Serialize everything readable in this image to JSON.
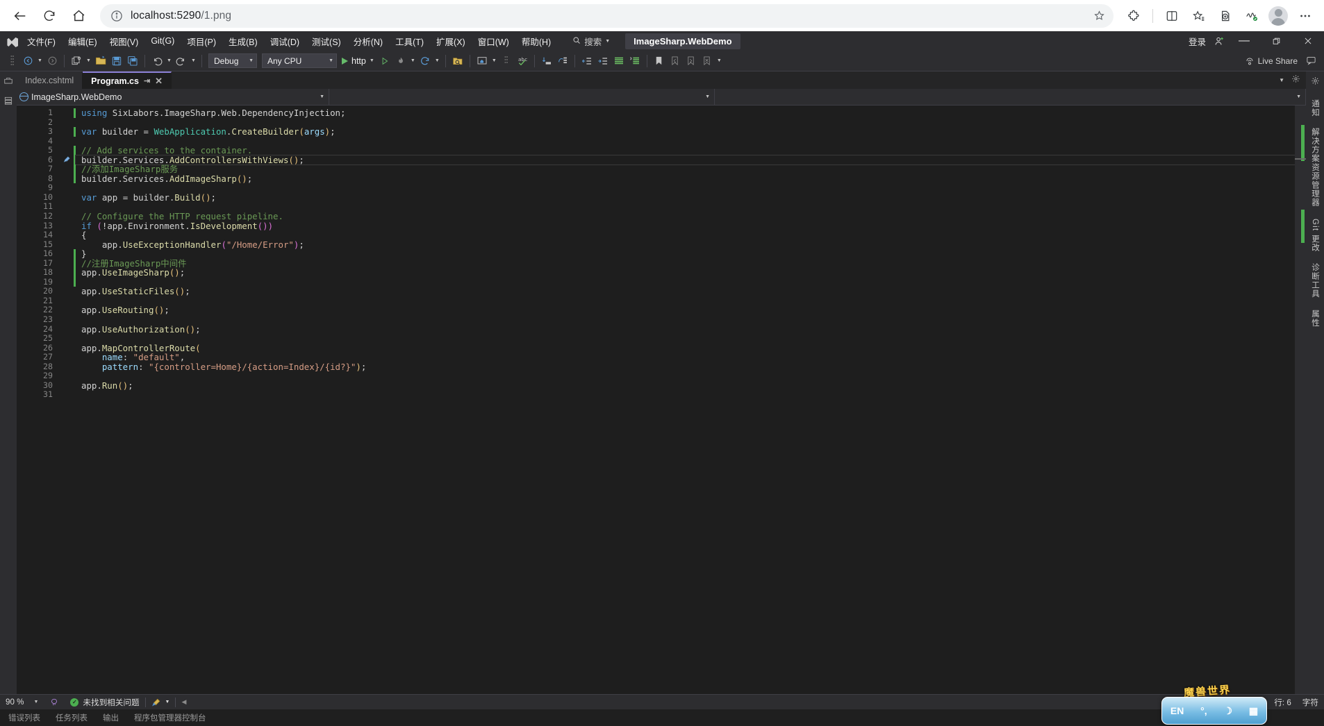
{
  "browser": {
    "url_host": "localhost:5290",
    "url_path": "/1.png",
    "back_icon": "back-arrow-icon",
    "reload_icon": "reload-icon",
    "home_icon": "home-icon",
    "info_icon": "info-circle-icon",
    "star_icon": "favorite-star-icon",
    "extensions_icon": "extensions-puzzle-icon",
    "split_icon": "split-screen-icon",
    "collections_icon": "collections-icon",
    "add_tab_icon": "add-to-collection-icon",
    "performance_icon": "browser-essentials-icon",
    "profile_icon": "profile-avatar-icon",
    "more_icon": "more-settings-icon"
  },
  "vs": {
    "menus": [
      {
        "label": "文件(F)",
        "key": "F"
      },
      {
        "label": "编辑(E)",
        "key": "E"
      },
      {
        "label": "视图(V)",
        "key": "V"
      },
      {
        "label": "Git(G)",
        "key": "G"
      },
      {
        "label": "项目(P)",
        "key": "P"
      },
      {
        "label": "生成(B)",
        "key": "B"
      },
      {
        "label": "调试(D)",
        "key": "D"
      },
      {
        "label": "测试(S)",
        "key": "S"
      },
      {
        "label": "分析(N)",
        "key": "N"
      },
      {
        "label": "工具(T)",
        "key": "T"
      },
      {
        "label": "扩展(X)",
        "key": "X"
      },
      {
        "label": "窗口(W)",
        "key": "W"
      },
      {
        "label": "帮助(H)",
        "key": "H"
      }
    ],
    "search_label": "搜索",
    "solution_title": "ImageSharp.WebDemo",
    "signin_label": "登录",
    "window_minimize": "—",
    "window_restore": "❐",
    "window_close": "✕",
    "toolbar": {
      "configuration": "Debug",
      "platform": "Any CPU",
      "run_target": "http",
      "live_share": "Live Share"
    },
    "tabs": [
      {
        "label": "Index.cshtml",
        "active": false
      },
      {
        "label": "Program.cs",
        "active": true
      }
    ],
    "navbar": {
      "project": "ImageSharp.WebDemo",
      "type": "",
      "member": ""
    },
    "right_rail": [
      "通知",
      "解决方案资源管理器",
      "Git 更改",
      "诊断工具",
      "属性"
    ],
    "statusbar": {
      "zoom": "90 %",
      "issues": "未找到相关问题",
      "line_label": "行: 6",
      "col_label": "字符"
    },
    "bottom_tabs": [
      "错误列表",
      "任务列表",
      "输出",
      "程序包管理器控制台"
    ],
    "ime": {
      "lang": "EN",
      "punct": "°,",
      "moon": "☽",
      "keyboard": "▦",
      "banner": "魔兽世界"
    }
  },
  "code": {
    "language": "csharp",
    "current_line": 6,
    "lines": [
      {
        "n": 1,
        "change": true,
        "html": "<span class=\"k\">using</span> SixLabors.ImageSharp.Web.DependencyInjection;"
      },
      {
        "n": 2,
        "change": false,
        "html": ""
      },
      {
        "n": 3,
        "change": true,
        "html": "<span class=\"k\">var</span> builder = <span class=\"t\">WebApplication</span>.<span class=\"m\">CreateBuilder</span><span class=\"par2\">(</span><span class=\"pl\">args</span><span class=\"par2\">)</span>;"
      },
      {
        "n": 4,
        "change": false,
        "html": ""
      },
      {
        "n": 5,
        "change": true,
        "html": "<span class=\"cm\">// Add services to the container.</span>"
      },
      {
        "n": 6,
        "change": true,
        "html": "builder.Services.<span class=\"m\">AddControllersWithViews</span><span class=\"par2\">()</span>;"
      },
      {
        "n": 7,
        "change": true,
        "html": "<span class=\"cm\">//添加ImageSharp服务</span>"
      },
      {
        "n": 8,
        "change": true,
        "html": "builder.Services.<span class=\"m\">AddImageSharp</span><span class=\"par2\">()</span>;"
      },
      {
        "n": 9,
        "change": false,
        "html": ""
      },
      {
        "n": 10,
        "change": false,
        "html": "<span class=\"k\">var</span> app = builder.<span class=\"m\">Build</span><span class=\"par2\">()</span>;"
      },
      {
        "n": 11,
        "change": false,
        "html": ""
      },
      {
        "n": 12,
        "change": false,
        "html": "<span class=\"cm\">// Configure the HTTP request pipeline.</span>"
      },
      {
        "n": 13,
        "change": false,
        "html": "<span class=\"k\">if</span> <span class=\"par\">(</span>!app.Environment.<span class=\"m\">IsDevelopment</span><span class=\"par\">()</span><span class=\"par\">)</span>"
      },
      {
        "n": 14,
        "change": false,
        "html": "{"
      },
      {
        "n": 15,
        "change": false,
        "html": "    app.<span class=\"m\">UseExceptionHandler</span><span class=\"par\">(</span><span class=\"s\">\"/Home/Error\"</span><span class=\"par\">)</span>;"
      },
      {
        "n": 16,
        "change": true,
        "html": "}"
      },
      {
        "n": 17,
        "change": true,
        "html": "<span class=\"cm\">//注册ImageSharp中间件</span>"
      },
      {
        "n": 18,
        "change": true,
        "html": "app.<span class=\"m\">UseImageSharp</span><span class=\"par2\">()</span>;"
      },
      {
        "n": 19,
        "change": true,
        "html": ""
      },
      {
        "n": 20,
        "change": false,
        "html": "app.<span class=\"m\">UseStaticFiles</span><span class=\"par2\">()</span>;"
      },
      {
        "n": 21,
        "change": false,
        "html": ""
      },
      {
        "n": 22,
        "change": false,
        "html": "app.<span class=\"m\">UseRouting</span><span class=\"par2\">()</span>;"
      },
      {
        "n": 23,
        "change": false,
        "html": ""
      },
      {
        "n": 24,
        "change": false,
        "html": "app.<span class=\"m\">UseAuthorization</span><span class=\"par2\">()</span>;"
      },
      {
        "n": 25,
        "change": false,
        "html": ""
      },
      {
        "n": 26,
        "change": false,
        "html": "app.<span class=\"m\">MapControllerRoute</span><span class=\"par2\">(</span>"
      },
      {
        "n": 27,
        "change": false,
        "html": "    <span class=\"pl\">name</span>: <span class=\"s\">\"default\"</span>,"
      },
      {
        "n": 28,
        "change": false,
        "html": "    <span class=\"pl\">pattern</span>: <span class=\"s\">\"{controller=Home}/{action=Index}/{id?}\"</span><span class=\"par2\">)</span>;"
      },
      {
        "n": 29,
        "change": false,
        "html": ""
      },
      {
        "n": 30,
        "change": false,
        "html": "app.<span class=\"m\">Run</span><span class=\"par2\">()</span>;"
      },
      {
        "n": 31,
        "change": false,
        "html": ""
      }
    ]
  }
}
